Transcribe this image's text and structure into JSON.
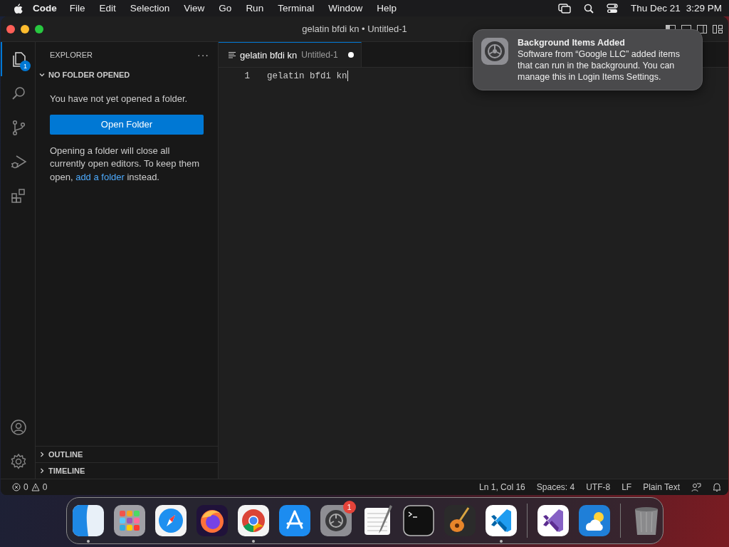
{
  "menu_bar": {
    "app_name": "Code",
    "items": [
      "File",
      "Edit",
      "Selection",
      "View",
      "Go",
      "Run",
      "Terminal",
      "Window",
      "Help"
    ],
    "date": "Thu Dec 21",
    "time": "3:29 PM"
  },
  "window": {
    "title": "gelatin bfdi kn • Untitled-1"
  },
  "activity_bar": {
    "items": [
      {
        "kind": "files",
        "selected": true,
        "badge": "1"
      },
      {
        "kind": "search",
        "selected": false
      },
      {
        "kind": "branch",
        "selected": false
      },
      {
        "kind": "debug",
        "selected": false
      },
      {
        "kind": "extensions",
        "selected": false
      }
    ],
    "bottom": [
      {
        "kind": "account"
      },
      {
        "kind": "gear"
      }
    ]
  },
  "sidebar": {
    "title": "EXPLORER",
    "more": "···",
    "sections": [
      {
        "label": "NO FOLDER OPENED",
        "expanded": true
      },
      {
        "label": "OUTLINE",
        "expanded": false
      },
      {
        "label": "TIMELINE",
        "expanded": false
      }
    ],
    "message": "You have not yet opened a folder.",
    "button": "Open Folder",
    "note_before": "Opening a folder will close all currently open editors. To keep them open,",
    "link": "add a folder",
    "note_after": "instead."
  },
  "editor": {
    "tabs": [
      {
        "label": "gelatin bfdi kn",
        "description": "Untitled-1",
        "dirty": true,
        "selected": true
      }
    ],
    "lines": [
      {
        "number": "1",
        "text": "gelatin bfdi kn"
      }
    ]
  },
  "notification": {
    "title": "Background Items Added",
    "body": "Software from “Google LLC” added items that can run in the background. You can manage this in Login Items Settings."
  },
  "status_bar": {
    "errors": "0",
    "warnings": "0",
    "items": [
      "Ln 1, Col 16",
      "Spaces: 4",
      "UTF-8",
      "LF",
      "Plain Text"
    ]
  },
  "dock": {
    "items": [
      {
        "kind": "finder",
        "running": true
      },
      {
        "kind": "launchpad",
        "running": false
      },
      {
        "kind": "safari",
        "running": false
      },
      {
        "kind": "firefox",
        "running": false
      },
      {
        "kind": "chrome",
        "running": true
      },
      {
        "kind": "appstore",
        "running": false
      },
      {
        "kind": "settings",
        "running": false,
        "badge": "1"
      },
      {
        "kind": "textedit",
        "running": false
      },
      {
        "kind": "terminal",
        "running": false
      },
      {
        "kind": "garageband",
        "running": false
      },
      {
        "kind": "vscode",
        "running": true
      },
      {
        "kind": "separator"
      },
      {
        "kind": "visualstudio",
        "running": false
      },
      {
        "kind": "weather",
        "running": false
      },
      {
        "kind": "separator"
      },
      {
        "kind": "trash",
        "running": false
      }
    ]
  }
}
